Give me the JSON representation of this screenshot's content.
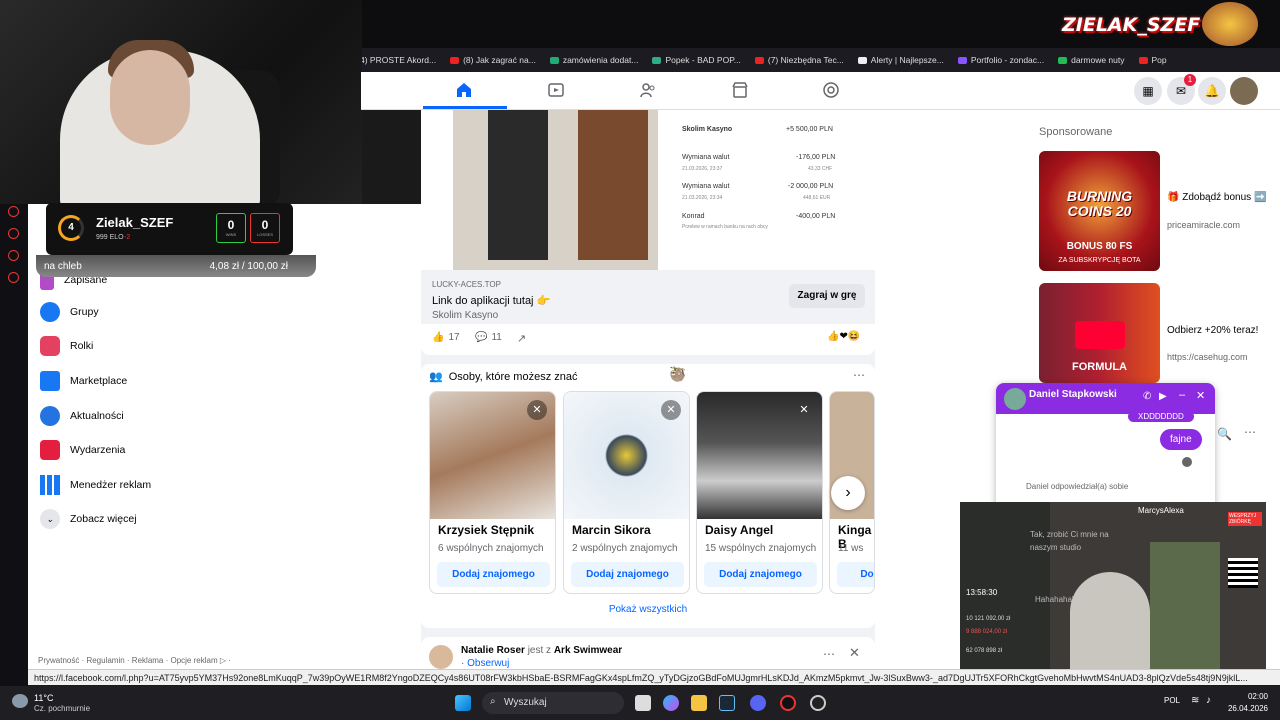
{
  "bookmarks": [
    {
      "label": "4) PROSTE Akord..."
    },
    {
      "label": "(8) Jak zagrać na..."
    },
    {
      "label": "zamówienia dodat..."
    },
    {
      "label": "Popek - BAD POP..."
    },
    {
      "label": "(7) Niezbędna Tec..."
    },
    {
      "label": "Alerty | Najlepsze..."
    },
    {
      "label": "Portfolio - zondac..."
    },
    {
      "label": "darmowe nuty"
    },
    {
      "label": "Pop"
    }
  ],
  "streamer_logo": "ZIELAK_SZEF",
  "elo_card": {
    "level": "4",
    "name": "Zielak_SZEF",
    "elo": "999 ELO",
    "delta": "-2",
    "wins": "0",
    "wins_label": "WINS",
    "losses": "0",
    "losses_label": "LOSSES"
  },
  "donation_bar": {
    "label": "na chleb",
    "current": "4,08 zł",
    "separator": "/",
    "goal": "100,00 zł"
  },
  "sidebar": {
    "items": [
      {
        "label": "Zapisane"
      },
      {
        "label": "Grupy"
      },
      {
        "label": "Rolki"
      },
      {
        "label": "Marketplace"
      },
      {
        "label": "Aktualności"
      },
      {
        "label": "Wydarzenia"
      },
      {
        "label": "Menedżer reklam"
      },
      {
        "label": "Zobacz więcej"
      }
    ],
    "footer": "Prywatność · Regulamin · Reklama · Opcje reklam ▷ ·"
  },
  "post1": {
    "transactions": [
      {
        "name": "Skolim Kasyno",
        "amount": "+5 500,00 PLN",
        "date": ""
      },
      {
        "name": "Wymiana walut",
        "amount": "-176,00 PLN",
        "date": "21.03.2026, 23:37",
        "sub": "43,33 CHF"
      },
      {
        "name": "Wymiana walut",
        "amount": "-2 000,00 PLN",
        "date": "21.03.2026, 23:34",
        "sub": "448,61 EUR"
      },
      {
        "name": "Konrad",
        "amount": "-400,00 PLN",
        "date": "Przelew w ramach banku na rach obcy"
      }
    ],
    "domain": "LUCKY-ACES.TOP",
    "link_title": "Link do aplikacji tutaj 👉",
    "sponsor": "Skolim Kasyno",
    "cta": "Zagraj w grę",
    "likes": "17",
    "comments": "11"
  },
  "pymk": {
    "title": "Osoby, które możesz znać",
    "people": [
      {
        "name": "Krzysiek Stępnik",
        "mutual": "6 wspólnych znajomych",
        "add": "Dodaj znajomego"
      },
      {
        "name": "Marcin Sikora",
        "mutual": "2 wspólnych znajomych",
        "add": "Dodaj znajomego"
      },
      {
        "name": "Daisy Angel",
        "mutual": "15 wspólnych znajomych",
        "add": "Dodaj znajomego"
      },
      {
        "name": "Kinga B",
        "mutual": "11 ws",
        "add": "Do"
      }
    ],
    "show_all": "Pokaż wszystkich"
  },
  "post2": {
    "author": "Natalie Roser",
    "connector": "jest z",
    "with": "Ark Swimwear",
    "follow": "· Obserwuj"
  },
  "sponsored": {
    "header": "Sponsorowane",
    "ads": [
      {
        "title": "🎁 Zdobądź bonus ➡️",
        "url": "priceamiracle.com",
        "img_text1": "BURNING",
        "img_text2": "COINS 20",
        "img_text3": "BONUS 80 FS",
        "img_text4": "ZA SUBSKRYPCJĘ BOTA"
      },
      {
        "title": "Odbierz +20% teraz!",
        "url": "https://casehug.com",
        "img_text1": "FORMULA"
      }
    ]
  },
  "messenger": {
    "contact": "Daniel Stapkowski",
    "top_msg": "XDDDDDDD",
    "msg": "fajne",
    "reply_note": "Daniel odpowiedział(a) sobie"
  },
  "stream2": {
    "name": "MarcysAlexa",
    "time": "13:58:30",
    "amount1": "10 121 092,00 zł",
    "amount2": "9 888 024,00 zł",
    "amount3": "62 078 898 zł",
    "overlay_text": "Tak, zrobić Ci mnie na naszym studio",
    "overlay_text2": "Hahahahaha",
    "badge": "WESPRZYJ ZBIÓRKĘ"
  },
  "status_url": "https://l.facebook.com/l.php?u=AT75yvp5YM37Hs92one8LmKuqqP_7w39pOyWE1RM8f2YngoDZEQCy4s86UT08rFW3kbHSbaE-BSRMFagGKx4spLfmZQ_yTyDGjzoGBdFoMUJgmrHLsKDJd_AKmzM5pkmvt_Jw-3lSuxBww3-_ad7DgUJTr5XFORhCkgtGvehoMbHwvtMS4nUAD3-8plQzVde5s48tj9N9jklL...",
  "taskbar": {
    "weather_temp": "11°C",
    "weather_desc": "Cz. pochmurnie",
    "search": "Wyszukaj",
    "lang": "POL",
    "time": "02:00",
    "date": "26.04.2026"
  },
  "colors": {
    "fb_blue": "#0866ff",
    "messenger_purple": "#8b2be2",
    "win": "#2ecc40",
    "loss": "#e33333"
  }
}
